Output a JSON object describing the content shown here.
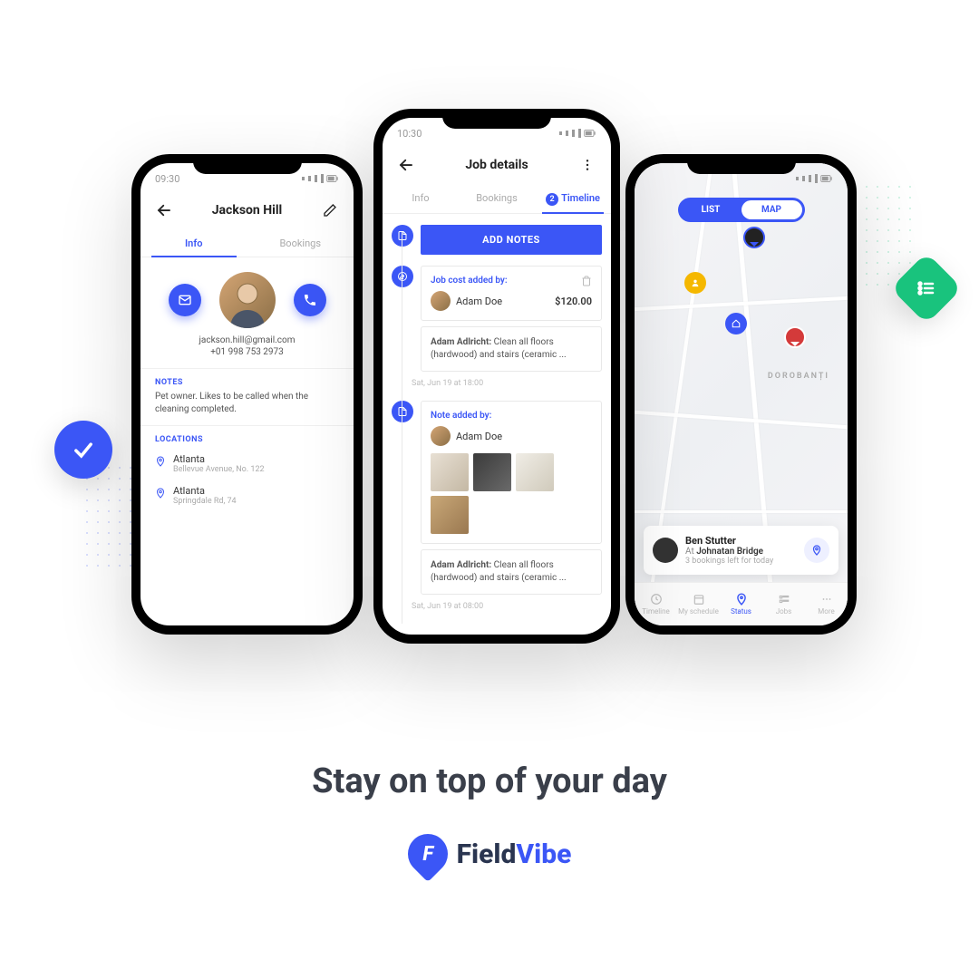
{
  "headline": "Stay on top of your day",
  "brand": {
    "name1": "Field",
    "name2": "Vibe"
  },
  "status_time_left": "09:30",
  "status_time_center": "10:30",
  "left": {
    "title": "Jackson Hill",
    "tabs": {
      "info": "Info",
      "bookings": "Bookings"
    },
    "email": "jackson.hill@gmail.com",
    "phone": "+01 998 753 2973",
    "notes_label": "NOTES",
    "notes_text": "Pet owner. Likes to be called when the cleaning completed.",
    "locations_label": "LOCATIONS",
    "locations": [
      {
        "city": "Atlanta",
        "line": "Bellevue Avenue, No. 122"
      },
      {
        "city": "Atlanta",
        "line": "Springdale Rd, 74"
      }
    ]
  },
  "center": {
    "title": "Job details",
    "tabs": {
      "info": "Info",
      "bookings": "Bookings",
      "timeline": "Timeline",
      "timeline_count": "2"
    },
    "add_notes": "ADD NOTES",
    "cost_card": {
      "title": "Job cost added by:",
      "user": "Adam Doe",
      "amount": "$120.00"
    },
    "task_text_prefix": "Adam Adlricht:",
    "task_text": " Clean all floors (hardwood) and stairs (ceramic ...",
    "ts1": "Sat, Jun 19 at 18:00",
    "note_card": {
      "title": "Note added by:",
      "user": "Adam Doe"
    },
    "ts2": "Sat, Jun 19 at 08:00"
  },
  "right": {
    "toggle": {
      "list": "LIST",
      "map": "MAP"
    },
    "area_label": "DOROBANȚI",
    "card": {
      "name": "Ben Stutter",
      "at": "At ",
      "loc": "Johnatan Bridge",
      "sub": "3 bookings left for today"
    },
    "nav": {
      "timeline": "Timeline",
      "schedule": "My schedule",
      "status": "Status",
      "jobs": "Jobs",
      "more": "More"
    }
  }
}
